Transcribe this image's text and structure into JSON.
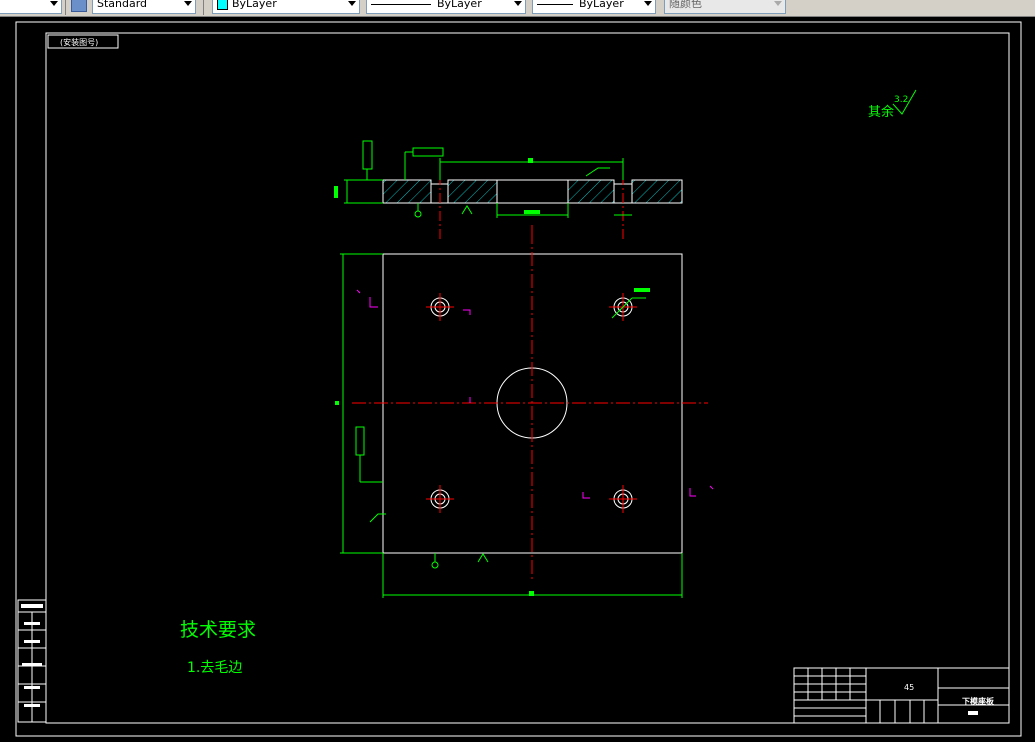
{
  "toolbar": {
    "text_style": "Standard",
    "color_layer": "ByLayer",
    "linetype": "ByLayer",
    "lineweight": "ByLayer",
    "plot_style": "随颜色"
  },
  "drawing": {
    "frame_tag": "(安装图号)",
    "surface_finish_note": "其余",
    "surface_finish_value": "3.2",
    "tech_req_title": "技术要求",
    "tech_req_item1": "1.去毛边",
    "title_block_name": "下模座板",
    "title_block_material": "45"
  },
  "colors": {
    "frame": "#ffffff",
    "dimension": "#00ff00",
    "center_line": "#ff0000",
    "hatch": "#00c0c0",
    "magenta": "#ff00ff",
    "text_green": "#00ff00"
  }
}
